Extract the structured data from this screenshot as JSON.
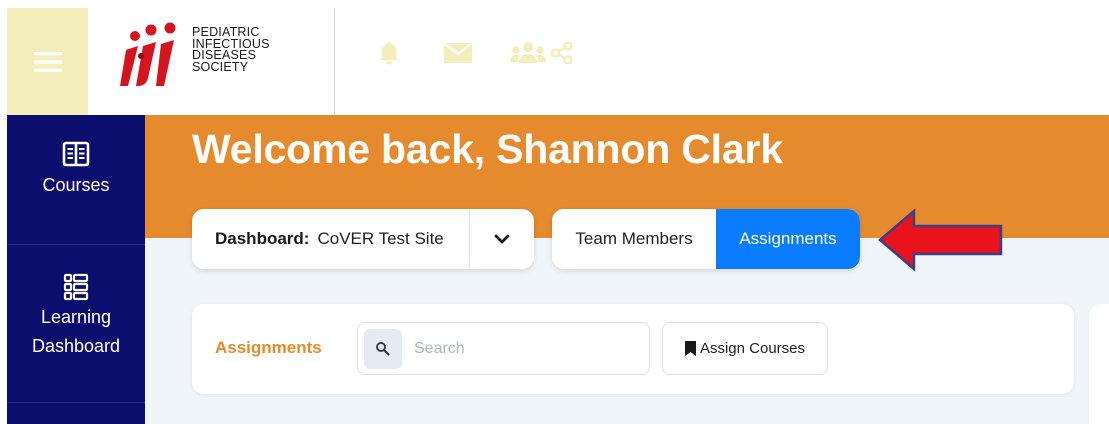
{
  "header": {
    "logo_lines": [
      "PEDIATRIC",
      "INFECTIOUS",
      "DISEASES",
      "SOCIETY"
    ],
    "icons": [
      "menu-icon",
      "bell-icon",
      "envelope-icon",
      "users-icon",
      "share-icon"
    ],
    "icon_color": "#f3eebc"
  },
  "sidebar": {
    "bg_color": "#0c0e6e",
    "items": [
      {
        "label": "Courses",
        "icon": "book-icon"
      },
      {
        "label": "Learning Dashboard",
        "label_lines": [
          "Learning",
          "Dashboard"
        ],
        "icon": "list-icon"
      }
    ]
  },
  "banner": {
    "welcome": "Welcome back, Shannon Clark",
    "bg_color": "#e68a2e"
  },
  "dashboard_select": {
    "label": "Dashboard:",
    "value": "CoVER Test Site"
  },
  "tabs": {
    "team_members": "Team Members",
    "assignments": "Assignments",
    "active": "Assignments",
    "active_color": "#0a7cff"
  },
  "annotation": {
    "arrow_color": "#e8131b"
  },
  "assignments_card": {
    "title": "Assignments",
    "search_placeholder": "Search",
    "assign_button": "Assign Courses"
  }
}
